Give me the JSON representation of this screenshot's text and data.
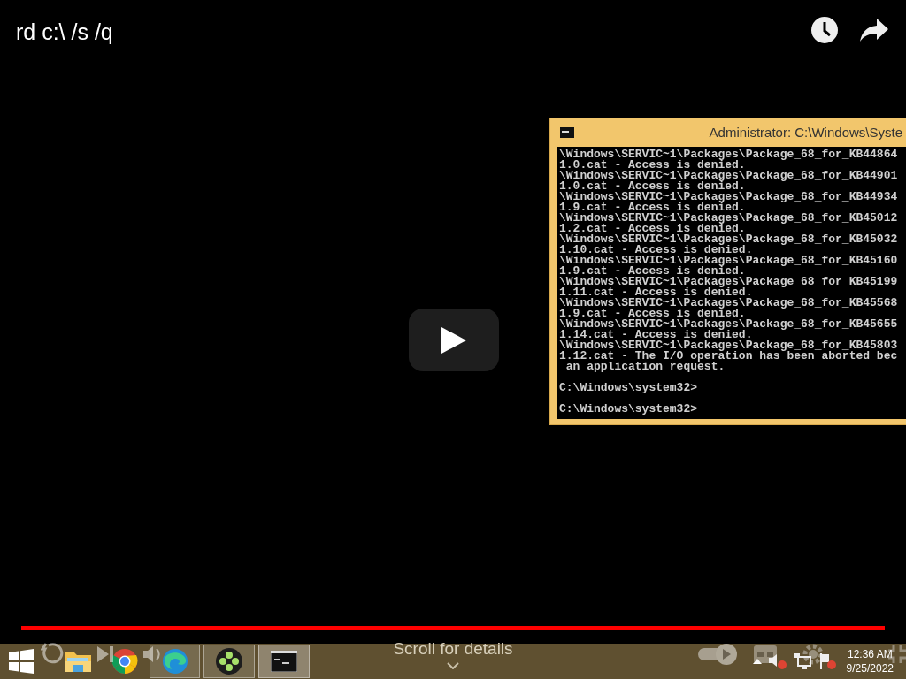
{
  "video": {
    "title": "rd c:\\ /s /q"
  },
  "console_window": {
    "title": "Administrator: C:\\Windows\\Syste",
    "blocks": [
      [
        "\\Windows\\SERVIC~1\\Packages\\Package_68_for_KB44864",
        "1.0.cat - Access is denied.",
        "\\Windows\\SERVIC~1\\Packages\\Package_68_for_KB44901",
        "1.0.cat - Access is denied.",
        "\\Windows\\SERVIC~1\\Packages\\Package_68_for_KB44934",
        "1.9.cat - Access is denied.",
        "\\Windows\\SERVIC~1\\Packages\\Package_68_for_KB45012",
        "1.2.cat - Access is denied.",
        "\\Windows\\SERVIC~1\\Packages\\Package_68_for_KB45032",
        "1.10.cat - Access is denied.",
        "\\Windows\\SERVIC~1\\Packages\\Package_68_for_KB45160",
        "1.9.cat - Access is denied.",
        "\\Windows\\SERVIC~1\\Packages\\Package_68_for_KB45199",
        "1.11.cat - Access is denied.",
        "\\Windows\\SERVIC~1\\Packages\\Package_68_for_KB45568",
        "1.9.cat - Access is denied.",
        "\\Windows\\SERVIC~1\\Packages\\Package_68_for_KB45655",
        "1.14.cat - Access is denied.",
        "\\Windows\\SERVIC~1\\Packages\\Package_68_for_KB45803",
        "1.12.cat - The I/O operation has been aborted bec",
        " an application request."
      ],
      [
        "C:\\Windows\\system32>"
      ],
      [
        "C:\\Windows\\system32>"
      ]
    ]
  },
  "taskbar": {
    "apps": [
      {
        "kind": "explorer",
        "running": false,
        "selected": false
      },
      {
        "kind": "chrome",
        "running": false,
        "selected": false
      },
      {
        "kind": "edge",
        "running": true,
        "selected": false
      },
      {
        "kind": "game",
        "running": true,
        "selected": false
      },
      {
        "kind": "console",
        "running": true,
        "selected": true
      }
    ],
    "clock": {
      "time": "12:36 AM",
      "date": "9/25/2022"
    }
  },
  "player": {
    "progress": {
      "level": 1
    },
    "scroll_hint": "Scroll for details"
  }
}
